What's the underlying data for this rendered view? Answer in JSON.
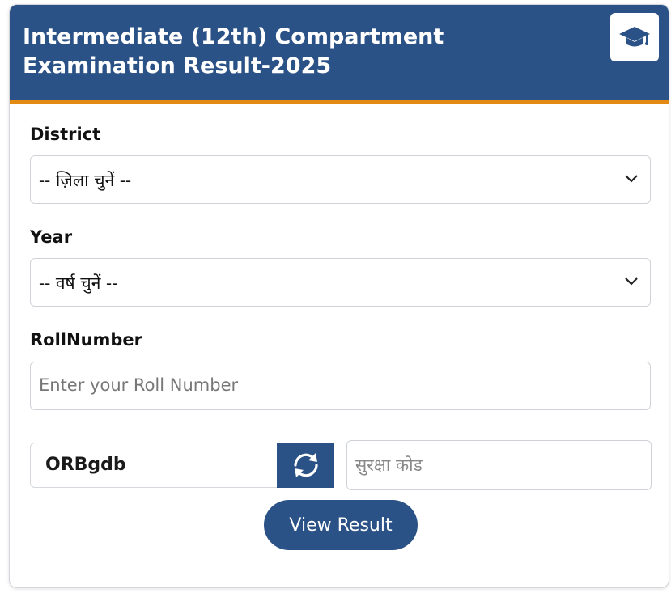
{
  "header": {
    "title": "Intermediate (12th) Compartment Examination Result-2025",
    "icon": "graduation-cap-icon",
    "bg_color": "#2b5286",
    "accent_color": "#e38a14"
  },
  "form": {
    "district": {
      "label": "District",
      "selected": "-- ज़िला चुनें --"
    },
    "year": {
      "label": "Year",
      "selected": "-- वर्ष चुनें --"
    },
    "roll_number": {
      "label": "RollNumber",
      "placeholder": "Enter your  Roll Number",
      "value": ""
    },
    "captcha": {
      "code": "ORBgdb",
      "refresh_icon": "refresh-icon",
      "input_placeholder": "सुरक्षा कोड"
    },
    "submit_label": "View Result"
  }
}
